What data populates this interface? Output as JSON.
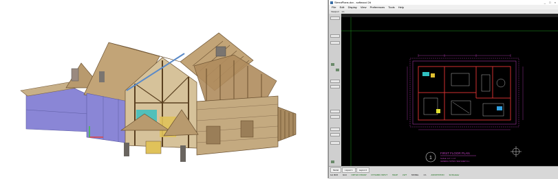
{
  "window": {
    "title": "SierraPlans.dcx - softwood 2d",
    "controls": "_ □ ×"
  },
  "menu": [
    "File",
    "Edit",
    "Display",
    "View",
    "Preferences",
    "Tools",
    "Help"
  ],
  "toolbar": {
    "zoom_label": "Viewport",
    "zoom_value": "1:1"
  },
  "drawing": {
    "sheet_title": "FIRST FLOOR PLAN",
    "scale_text": "SCALE: 1/4\" = 1'-0\"",
    "note_text": "GENERAL NOTES: SEE SHEET A-1",
    "view_marker": "1"
  },
  "status": {
    "tabs": [
      "Model",
      "Layout 1",
      "Layout 2"
    ],
    "command_items": [
      "1st 3D/2",
      "Grid",
      "ORTHO OSNAP",
      "DYNAMIC INPUT",
      "SNAP",
      "LWT",
      "MODEL",
      "1:1",
      "ANNOTATION",
      "3d Modeler"
    ]
  },
  "colors": {
    "canvas_bg": "#000000",
    "wall_red": "#d03030",
    "dim_magenta": "#c040c0",
    "grid_green": "#20a020",
    "roof_tan": "#b89a6e",
    "glass_blue": "#8a86d6"
  },
  "icons": [
    "app-icon",
    "minimize-icon",
    "maximize-icon",
    "close-icon",
    "north-arrow-icon"
  ]
}
